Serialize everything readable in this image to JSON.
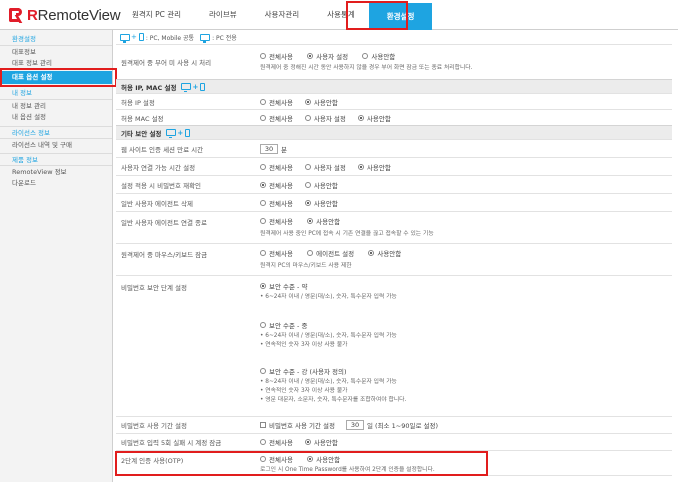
{
  "logo": {
    "brand_r": "R",
    "brand_text": "RemoteView"
  },
  "topnav": [
    "원격지 PC 관리",
    "라이브뷰",
    "사용자관리",
    "사용통계",
    "환경설정"
  ],
  "sidebar": [
    {
      "label": "환경설정",
      "kind": "cat"
    },
    {
      "label": "대표정보",
      "kind": "item"
    },
    {
      "label": "대표 정보 관리",
      "kind": "item"
    },
    {
      "label": "대표 옵션 설정",
      "kind": "active"
    },
    {
      "label": "내 정보",
      "kind": "cat"
    },
    {
      "label": "내 정보 관리",
      "kind": "item"
    },
    {
      "label": "내 옵션 설정",
      "kind": "item"
    },
    {
      "label": "라이선스 정보",
      "kind": "cat"
    },
    {
      "label": "라이선스 내역 및 구매",
      "kind": "item"
    },
    {
      "label": "제품 정보",
      "kind": "cat"
    },
    {
      "label": "RemoteView 정보",
      "kind": "item"
    },
    {
      "label": "다운로드",
      "kind": "item"
    }
  ],
  "legend": {
    "common": ": PC, Mobile 공통",
    "pc_only": ": PC 전용"
  },
  "rows": {
    "idle": {
      "label": "원격제어 중 부어 미 사용 시 처리",
      "opts": [
        "전체사용",
        "사용자 설정",
        "사용안함"
      ],
      "note": "원격제어 중 정해진 시간 동안 사용하지 않을 경우 부어 화면 잠금 또는 종료 처리합니다."
    },
    "sec_ipmac": "허용 IP, MAC 설정",
    "ip": {
      "label": "허용 IP 설정",
      "opts": [
        "전체사용",
        "사용안함"
      ]
    },
    "mac": {
      "label": "허용 MAC 설정",
      "opts": [
        "전체사용",
        "사용자 설정",
        "사용안함"
      ]
    },
    "sec_etc": "기타 보안 설정",
    "web_timeout": {
      "label": "웹 사이트 인증 세션 만료 시간",
      "value": "30",
      "unit": "분"
    },
    "user_conn": {
      "label": "사용자 연결 가능 시간 설정",
      "opts": [
        "전체사용",
        "사용자 설정",
        "사용안함"
      ]
    },
    "pw_confirm": {
      "label": "설정 적용 시 비밀번호 재확인",
      "opts": [
        "전체사용",
        "사용안함"
      ]
    },
    "agent_del": {
      "label": "일반 사용자 에이전트 삭제",
      "opts": [
        "전체사용",
        "사용안함"
      ]
    },
    "agent_end": {
      "label": "일반 사용자 에이전트 연결 종료",
      "opts": [
        "전체사용",
        "사용안함"
      ],
      "note": "원격제어 사용 중인 PC에 접속 시 기존 연결을 끊고 접속할 수 있는 기능"
    },
    "input_lock": {
      "label": "원격제어 중 마우스/키보드 잠금",
      "opts": [
        "전체사용",
        "에이전트 설정",
        "사용안함"
      ],
      "note": "원격지 PC의 마우스/키보드 사용 제한"
    },
    "pw_level": {
      "label": "비밀번호 보안 단계 설정",
      "levels": [
        {
          "title": "보안 수준 - 약",
          "notes": [
            "• 6~24자 이내 / 영문(대/소), 숫자, 특수문자 입력 가능"
          ]
        },
        {
          "title": "보안 수준 - 중",
          "notes": [
            "• 6~24자 이내 / 영문(대/소), 숫자, 특수문자 입력 가능",
            "• 연속적인 숫자 3자 이상 사용 불가"
          ]
        },
        {
          "title": "보안 수준 - 강 (사용자 정의)",
          "notes": [
            "• 8~24자 이내 / 영문(대/소), 숫자, 특수문자 입력 가능",
            "• 연속적인 숫자 3자 이상 사용 불가",
            "• 영문 대문자, 소문자, 숫자, 특수문자를 조합하여야 합니다."
          ]
        }
      ]
    },
    "pw_period": {
      "label": "비밀번호 사용 기간 설정",
      "check": "비밀번호 사용 기간 설정",
      "value": "30",
      "unit": "일 (최소 1~90일로 설정)"
    },
    "pw_fail": {
      "label": "비밀번호 입력 5회 실패 시 계정 잠금",
      "opts": [
        "전체사용",
        "사용안함"
      ]
    },
    "otp": {
      "label": "2단계 인증 사용(OTP)",
      "opts": [
        "전체사용",
        "사용안함"
      ],
      "note": "로그인 시 One Time Password를 사용하여 2단계 인증을 설정합니다."
    }
  },
  "colors": {
    "accent": "#1ea4e1",
    "highlight": "#e11d1d",
    "brand": "#e11d2a"
  }
}
